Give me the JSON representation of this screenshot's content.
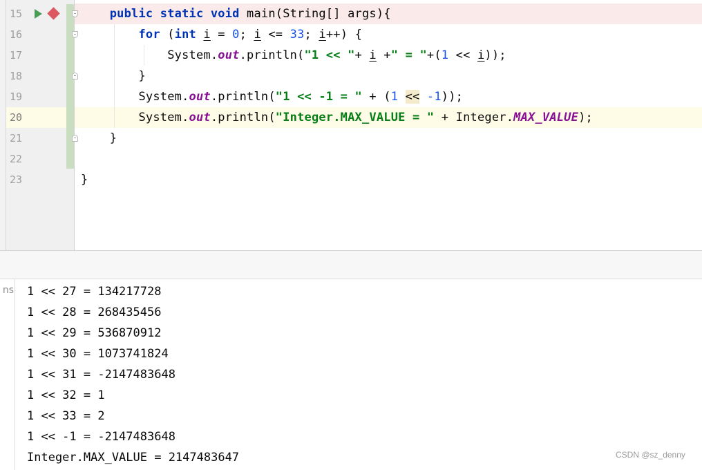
{
  "editor": {
    "line_numbers": [
      "15",
      "16",
      "17",
      "18",
      "19",
      "20",
      "21",
      "22",
      "23"
    ],
    "lines": {
      "l15": {
        "kw1": "public",
        "kw2": "static",
        "kw3": "void",
        "rest": " main(String[] args){"
      },
      "l16": {
        "kw": "for",
        "p1": " (",
        "kw_int": "int",
        "sp": " ",
        "i1": "i",
        "eq": " = ",
        "n0": "0",
        "semi1": "; ",
        "i2": "i",
        "le": " <= ",
        "n33": "33",
        "semi2": "; ",
        "i3": "i",
        "inc": "++) {"
      },
      "l17": {
        "sys": "System.",
        "out": "out",
        "pr": ".println(",
        "s1": "\"1 << \"",
        "plus1": "+ ",
        "iv": "i",
        "plus2": " +",
        "s2": "\" = \"",
        "expr": "+(",
        "one": "1",
        "shift": " << ",
        "iv2": "i",
        "end": "));"
      },
      "l18": {
        "text": "}"
      },
      "l19": {
        "sys": "System.",
        "out": "out",
        "pr": ".println(",
        "s": "\"1 << -1 = \"",
        "mid": " + (",
        "one": "1",
        "sp": " ",
        "op": "<<",
        "sp2": " ",
        "neg": "-1",
        "end": "));"
      },
      "l20": {
        "sys": "System.",
        "out": "out",
        "pr": ".println(",
        "s": "\"Integer.MAX_VALUE = \"",
        "mid": " + Integer.",
        "fld": "MAX_VALUE",
        "end": ");"
      },
      "l21": {
        "text": "}"
      },
      "l23": {
        "text": "}"
      }
    }
  },
  "console": {
    "gutter_text": "ns",
    "output": [
      "1 << 27 = 134217728",
      "1 << 28 = 268435456",
      "1 << 29 = 536870912",
      "1 << 30 = 1073741824",
      "1 << 31 = -2147483648",
      "1 << 32 = 1",
      "1 << 33 = 2",
      "1 << -1 = -2147483648",
      "Integer.MAX_VALUE = 2147483647"
    ]
  },
  "watermark": "CSDN @sz_denny",
  "icons": {
    "run": "run-gutter-icon",
    "breakpoint": "breakpoint-icon",
    "fold": "fold-icon"
  },
  "colors": {
    "keyword": "#0033b3",
    "string": "#067d17",
    "number": "#1750eb",
    "field": "#871094",
    "breakpoint": "#db5860",
    "run": "#499c54"
  }
}
